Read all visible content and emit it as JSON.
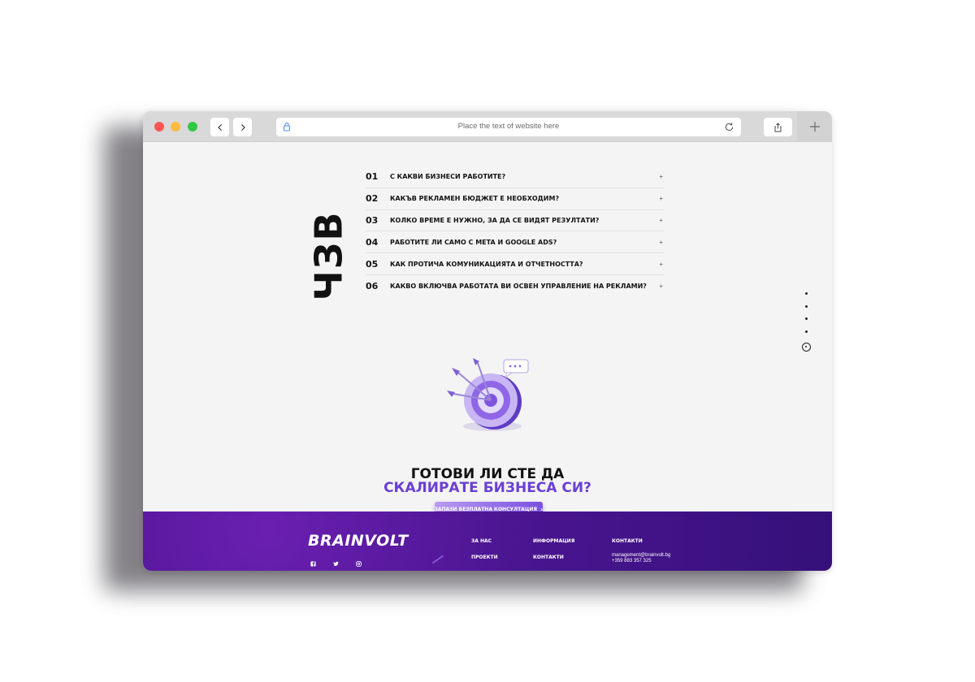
{
  "browser": {
    "url_placeholder": "Place the text of website here"
  },
  "faq": {
    "title": "ЧЗВ",
    "items": [
      {
        "num": "01",
        "question": "С КАКВИ БИЗНЕСИ РАБОТИТЕ?",
        "toggle": "+"
      },
      {
        "num": "02",
        "question": "КАКЪВ РЕКЛАМЕН БЮДЖЕТ Е НЕОБХОДИМ?",
        "toggle": "+"
      },
      {
        "num": "03",
        "question": "КОЛКО ВРЕМЕ Е НУЖНО, ЗА ДА СЕ ВИДЯТ РЕЗУЛТАТИ?",
        "toggle": "+"
      },
      {
        "num": "04",
        "question": "РАБОТИТЕ ЛИ САМО С META И GOOGLE ADS?",
        "toggle": "+"
      },
      {
        "num": "05",
        "question": "КАК ПРОТИЧА КОМУНИКАЦИЯТА И ОТЧЕТНОСТТА?",
        "toggle": "+"
      },
      {
        "num": "06",
        "question": "КАКВО ВКЛЮЧВА РАБОТАТА ВИ ОСВЕН УПРАВЛЕНИЕ НА РЕКЛАМИ?",
        "toggle": "+"
      }
    ]
  },
  "cta": {
    "line1": "ГОТОВИ ЛИ СТЕ ДА",
    "line2": "СКАЛИРАТЕ БИЗНЕСА СИ?",
    "button_label": "ЗАПАЗИ БЕЗПЛАТНА КОНСУЛТАЦИЯ",
    "button_icon": "›"
  },
  "footer": {
    "logo": "BRAINVOLT",
    "col1": {
      "heading": "ЗА НАС",
      "link": "ПРОЕКТИ"
    },
    "col2": {
      "heading": "ИНФОРМАЦИЯ",
      "link": "КОНТАКТИ"
    },
    "col3": {
      "heading": "КОНТАКТИ",
      "email": "management@brainvolt.bg",
      "phone": "+359 883 357 325"
    },
    "socials": [
      "facebook-icon",
      "twitter-icon",
      "instagram-icon"
    ]
  },
  "colors": {
    "accent": "#6a3fd3",
    "footer_bg": "#4a1590",
    "page_bg": "#f4f4f4"
  }
}
